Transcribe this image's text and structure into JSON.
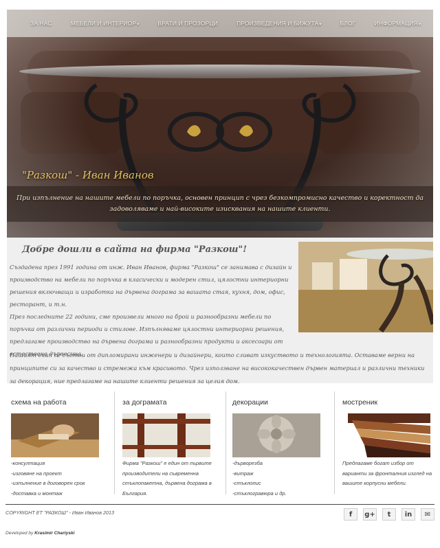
{
  "nav": {
    "items": [
      {
        "label": "ЗА НАС",
        "has_dropdown": false
      },
      {
        "label": "МЕБЕЛИ И ИНТЕРИОР",
        "has_dropdown": true
      },
      {
        "label": "ВРАТИ И ПРОЗОРЦИ",
        "has_dropdown": false
      },
      {
        "label": "ПРОИЗВЕДЕНИЯ И БИЖУТА",
        "has_dropdown": true
      },
      {
        "label": "БЛОГ",
        "has_dropdown": false
      },
      {
        "label": "ИНФОРМАЦИЯ",
        "has_dropdown": true
      }
    ],
    "caret": "▾"
  },
  "hero": {
    "title": "\"Разкош\" - Иван Иванов",
    "slogan": "При изпълнение на нашите мебели по поръчка, основен принцип с чрез безкомпромисно качество и коректност да задоволяваме и най-високите изисквания на нашите клиенти."
  },
  "welcome": {
    "heading": "Добре дошли в сайта на фирма \"Разкош\"!",
    "paragraph1": "Създадена през 1991 година от инж. Иван Иванов, фирма \"Разкош\" се занимава с дизайн и производство на мебели по поръчка в класически и модерен стил, цялостни интериорни решения включващи и изработка на дървена дограма за вашата стая, кухня, дом, офис, ресторант, и т.н.",
    "paragraph2": "През последните 22 години, сме произвели много на брой и разнообразни мебели по поръчка от различни периоди и стилове. Изпълняваме цялостни интериорни решения, предлагаме производство на дървена дограма и разнообразни продукти и аксесоари от естествена дървесина.",
    "paragraph3": "Нашият екип се състои от дипломирани инженери и дизайнери, които сливат изкуството и технологията. Оставаме верни на принципите си за качество и стремежа към красивото. Чрез използване на висококачествен дървен материал и различни техники за декорация, ние предлагаме на нашите клиенти решения за целия дом."
  },
  "features": [
    {
      "title": "схема на работа",
      "image": "wood-planing-photo",
      "lines": [
        "-консултация",
        "-изговяне на проект",
        "-изпълнение в договорен срок",
        "-доставка и монтаж"
      ]
    },
    {
      "title": "за дограмата",
      "image": "wooden-window-photo",
      "lines": [
        "Фирма \"Разкош\" е един от първите производители на съвременна стъклопакетна, дървена дограма в България."
      ]
    },
    {
      "title": "декорации",
      "image": "wood-carving-rosette-photo",
      "lines": [
        "-дърворезба",
        "-витраж",
        "-стъклопис",
        "-стъклогравюра и др."
      ]
    },
    {
      "title": "мостреник",
      "image": "wood-samples-photo",
      "lines": [
        "Предлагаме богат избор от варианти за фронталния изглед на вашите корпусни мебели."
      ]
    }
  ],
  "footer": {
    "copyright": "COPYRIGHT ЕТ \"РАЗКОШ\" - Иван Иванов 2013",
    "developer_prefix": "Developed by",
    "developer_name": "Krasimir Chariyski",
    "social": [
      {
        "icon": "facebook-icon",
        "glyph": "f"
      },
      {
        "icon": "google-plus-icon",
        "glyph": "g+"
      },
      {
        "icon": "twitter-icon",
        "glyph": "t"
      },
      {
        "icon": "linkedin-icon",
        "glyph": "in"
      },
      {
        "icon": "email-icon",
        "glyph": "✉"
      }
    ]
  }
}
